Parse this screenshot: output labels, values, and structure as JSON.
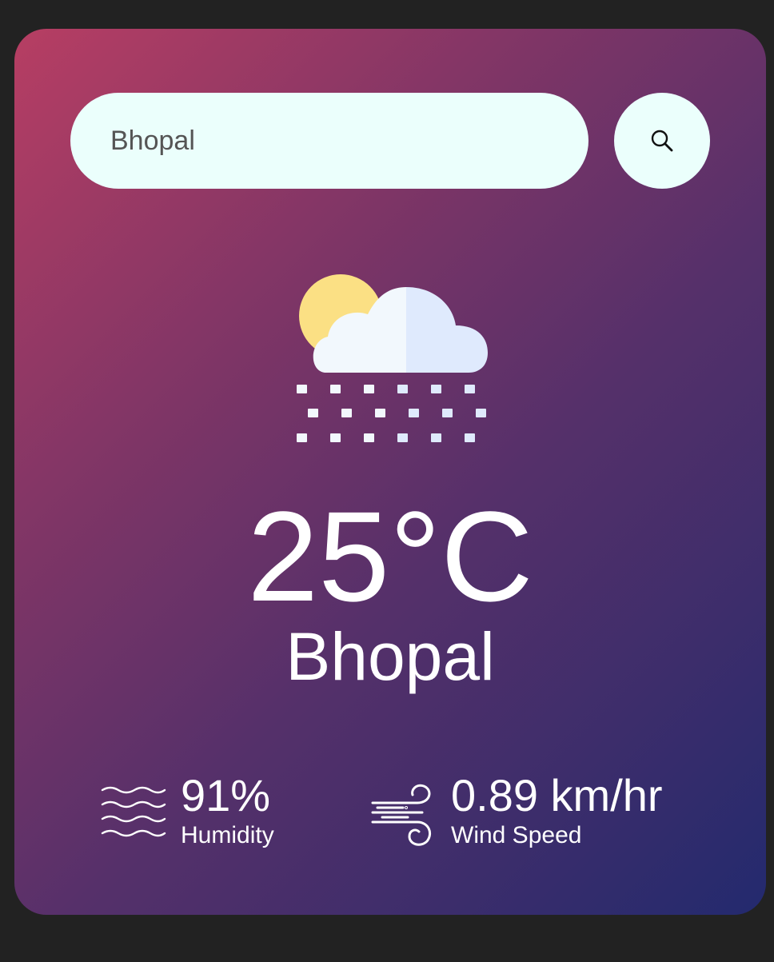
{
  "search": {
    "value": "Bhopal",
    "placeholder": ""
  },
  "weather": {
    "icon": "partly-cloudy-snow-icon",
    "temperature": "25°C",
    "city": "Bhopal"
  },
  "details": {
    "humidity": {
      "icon": "humidity-waves-icon",
      "value": "91%",
      "label": "Humidity"
    },
    "wind": {
      "icon": "wind-icon",
      "value": "0.89 km/hr",
      "label": "Wind Speed"
    }
  },
  "colors": {
    "card_gradient_start": "#b73e63",
    "card_gradient_end": "#232a6e",
    "input_background": "#ebfffc",
    "sun": "#fbe084",
    "cloud_light": "#f2f8fd",
    "cloud_shade": "#dfeafd"
  }
}
